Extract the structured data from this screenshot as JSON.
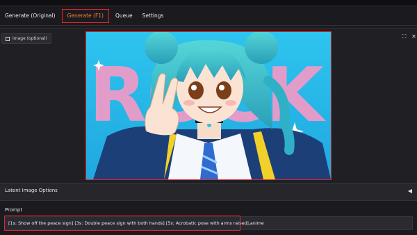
{
  "tabs": [
    {
      "label": "Generate (Original)"
    },
    {
      "label": "Generate (F1)"
    },
    {
      "label": "Queue"
    },
    {
      "label": "Settings"
    }
  ],
  "active_tab": "Generate (F1)",
  "image_panel": {
    "label": "Image (optional)",
    "expand_icon": "expand-icon",
    "close_icon": "close-icon",
    "image_text": "ROCK"
  },
  "latent_options": {
    "label": "Latent Image Options",
    "toggle_icon": "triangle-left-icon"
  },
  "prompt": {
    "label": "Prompt",
    "value": "[1s: Show off the peace sign] [3s: Double peace sign with both hands] [5s: Acrobatic pose with arms raised],anime"
  },
  "colors": {
    "accent": "#ff7a2e",
    "highlight_border": "#e0242a",
    "background": "#1b1b1f"
  }
}
